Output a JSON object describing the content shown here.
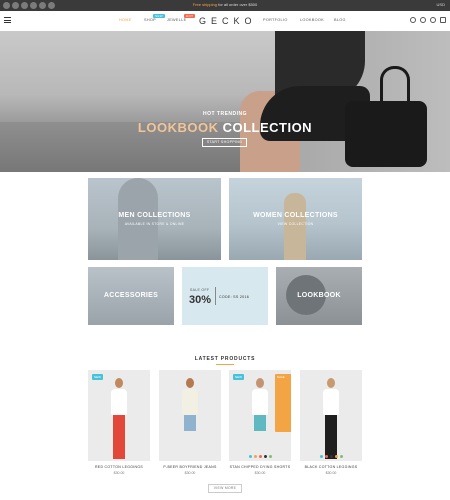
{
  "topbar": {
    "promo_prefix": "Free shipping",
    "promo_suffix": " for all order over $500",
    "currency": "USD"
  },
  "header": {
    "nav_left": [
      {
        "label": "HOME"
      },
      {
        "label": "SHOP",
        "badge": "NEW"
      },
      {
        "label": "JEWELLE",
        "badge": "HOT"
      }
    ],
    "logo": "GECKO",
    "nav_right": [
      {
        "label": "PORTFOLIO"
      },
      {
        "label": "LOOKBOOK"
      },
      {
        "label": "BLOG"
      }
    ]
  },
  "hero": {
    "subtitle": "HOT TRENDING",
    "title_accent": "LOOKBOOK",
    "title_rest": " COLLECTION",
    "cta": "START SHOPPING"
  },
  "collections": {
    "men": {
      "title": "MEN COLLECTIONS",
      "subtitle": "AVAILABLE IN STORE & ONLINE"
    },
    "women": {
      "title": "WOMEN COLLECTIONS",
      "subtitle": "VIEW COLLECTION"
    },
    "accessories": {
      "title": "ACCESSORIES"
    },
    "sale": {
      "label": "SALE OFF",
      "percent": "30%",
      "code": "CODE: SS 2016"
    },
    "lookbook": {
      "title": "LOOKBOOK"
    }
  },
  "latest": {
    "title": "LATEST PRODUCTS",
    "products": [
      {
        "name": "RED COTTON LEGGINGS",
        "price": "$30.00",
        "badge": "NEW"
      },
      {
        "name": "P-BEER BOYFRIEND JEANS",
        "price": "$30.00",
        "badge": ""
      },
      {
        "name": "STAN CHIPPED DYING SHORTS",
        "price": "$30.00",
        "badge": "NEW",
        "badge2": "SALE"
      },
      {
        "name": "BLACK COTTON LEGGINGS",
        "price": "$30.00",
        "badge": ""
      }
    ],
    "view_more": "VIEW MORE"
  },
  "colors": {
    "accent": "#f3a545",
    "new_badge": "#46c3d8",
    "hot_badge": "#f26a4f"
  }
}
